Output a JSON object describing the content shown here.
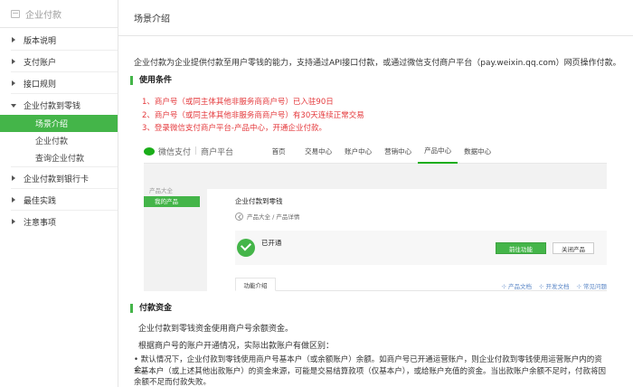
{
  "sidebar": {
    "title": "企业付款",
    "items": [
      {
        "label": "版本说明"
      },
      {
        "label": "支付账户"
      },
      {
        "label": "接口规则"
      },
      {
        "label": "企业付款到零钱"
      },
      {
        "label": "企业付款到银行卡"
      },
      {
        "label": "最佳实践"
      },
      {
        "label": "注意事项"
      }
    ],
    "sub_items": [
      {
        "label": "场景介绍"
      },
      {
        "label": "企业付款"
      },
      {
        "label": "查询企业付款"
      }
    ]
  },
  "main": {
    "page_title": "场景介绍",
    "intro": "企业付款为企业提供付款至用户零钱的能力，支持通过API接口付款，或通过微信支付商户平台（pay.weixin.qq.com）网页操作付款。",
    "section1_title": "使用条件",
    "conditions": [
      "1、商户号（或同主体其他非服务商商户号）已入驻90日",
      "2、商户号（或同主体其他非服务商商户号）有30天连续正常交易",
      "3、登录微信支付商户平台-产品中心，开通企业付款。"
    ],
    "section2_title": "付款资金",
    "funds_line1": "企业付款到零钱资金使用商户号余额资金。",
    "funds_line2": "根据商户号的账户开通情况，实际出款账户有做区别：",
    "bullet1": "• 默认情况下，企业付款到零钱使用商户号基本户（或余额账户）余额。如商户号已开通运营账户，则企业付款到零钱使用运营账户内的资金。",
    "bullet2": "• 基本户（或上述其他出款账户）的资金来源，可能是交易结算款项（仅基本户），或给账户充值的资金。当出款账户余额不足时，付款将因余额不足而付款失败。"
  },
  "mock": {
    "logo_text": "微信支付",
    "logo_sub": "商户平台",
    "nav": [
      "首页",
      "交易中心",
      "账户中心",
      "营销中心",
      "产品中心",
      "数据中心"
    ],
    "nav_active": "产品中心",
    "left_title": "产品大全",
    "left_active": "我的产品",
    "panel_title": "企业付款到零钱",
    "crumb": "产品大全 / 产品详情",
    "status": "已开通",
    "btn_go": "前往功能",
    "btn_close": "关闭产品",
    "tab": "功能介绍",
    "links": [
      "产品文档",
      "开发文档",
      "常见问题"
    ]
  },
  "colors": {
    "accent": "#44b549",
    "alert": "#e4393c",
    "link": "#5b87c7"
  }
}
